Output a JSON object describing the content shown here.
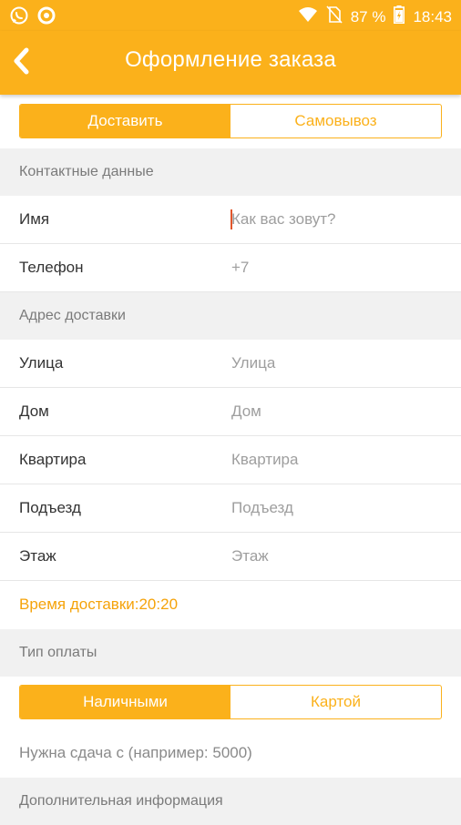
{
  "status_bar": {
    "battery_percent": "87 %",
    "time": "18:43",
    "left_icons": [
      "whatsapp-icon",
      "notification-circle-icon"
    ],
    "right_icons": [
      "wifi-icon",
      "no-sim-icon",
      "battery-icon"
    ]
  },
  "toolbar": {
    "title": "Оформление заказа",
    "back_icon": "chevron-left-icon"
  },
  "delivery_toggle": {
    "options": [
      "Доставить",
      "Самовывоз"
    ],
    "selected": "Доставить"
  },
  "contacts": {
    "header": "Контактные данные",
    "name": {
      "label": "Имя",
      "placeholder": "Как вас зовут?"
    },
    "phone": {
      "label": "Телефон",
      "value": "+7"
    }
  },
  "address": {
    "header": "Адрес доставки",
    "fields": [
      {
        "label": "Улица",
        "placeholder": "Улица"
      },
      {
        "label": "Дом",
        "placeholder": "Дом"
      },
      {
        "label": "Квартира",
        "placeholder": "Квартира"
      },
      {
        "label": "Подъезд",
        "placeholder": "Подъезд"
      },
      {
        "label": "Этаж",
        "placeholder": "Этаж"
      }
    ]
  },
  "delivery_time": "Время доставки:20:20",
  "payment": {
    "header": "Тип оплаты",
    "options": [
      "Наличными",
      "Картой"
    ],
    "selected": "Наличными",
    "change_placeholder": "Нужна сдача с (например: 5000)"
  },
  "additional": {
    "header": "Дополнительная информация"
  },
  "colors": {
    "accent": "#fbb11b",
    "time_text": "#f5a30a"
  }
}
